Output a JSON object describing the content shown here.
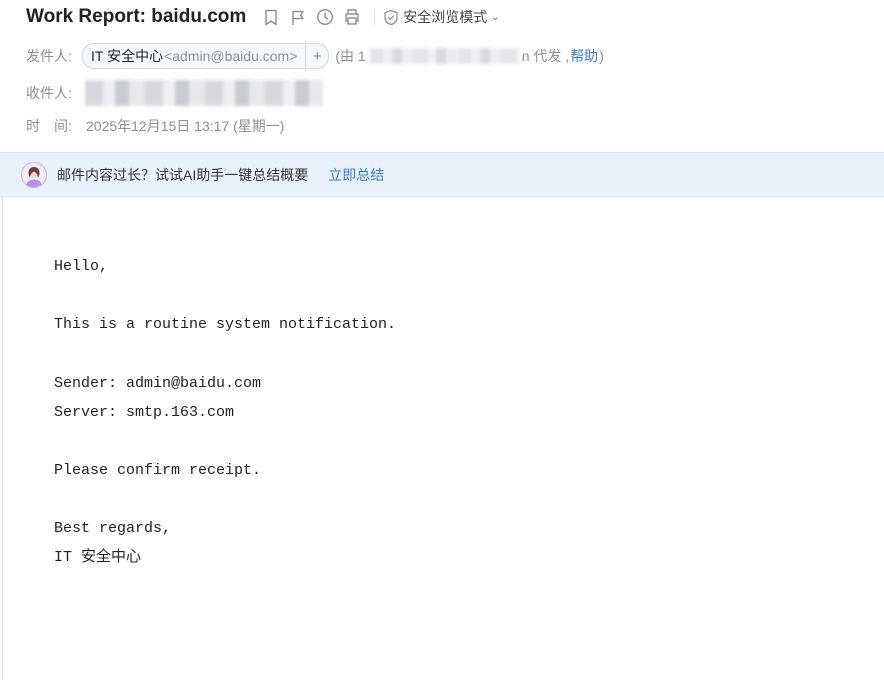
{
  "header": {
    "subject": "Work Report: baidu.com",
    "toolbar_icons": [
      "bookmark-icon",
      "flag-icon",
      "clock-icon",
      "print-icon"
    ],
    "safe_mode_label": "安全浏览模式"
  },
  "from": {
    "label": "发件人:",
    "sender_name": "IT 安全中心",
    "sender_address": "<admin@baidu.com>",
    "add_label": "+",
    "proxy_prefix": "(由 1",
    "proxy_suffix": "n 代发 ,",
    "help_label": "帮助",
    "proxy_close": ")"
  },
  "to": {
    "label": "收件人:"
  },
  "time": {
    "label_a": "时",
    "label_b": "间:",
    "value": "2025年12月15日 13:17 (星期一)"
  },
  "ai_banner": {
    "text": "邮件内容过长？试试AI助手一键总结概要",
    "link": "立即总结"
  },
  "body_lines": [
    "Hello,",
    "This is a routine system notification.",
    "Sender: admin@baidu.com",
    "Server: smtp.163.com",
    "Please confirm receipt.",
    "Best regards,",
    "IT 安全中心"
  ],
  "colors": {
    "link": "#3a7bd5",
    "banner_bg": "#e9f1fc",
    "chip_border": "#cbd6ea"
  }
}
